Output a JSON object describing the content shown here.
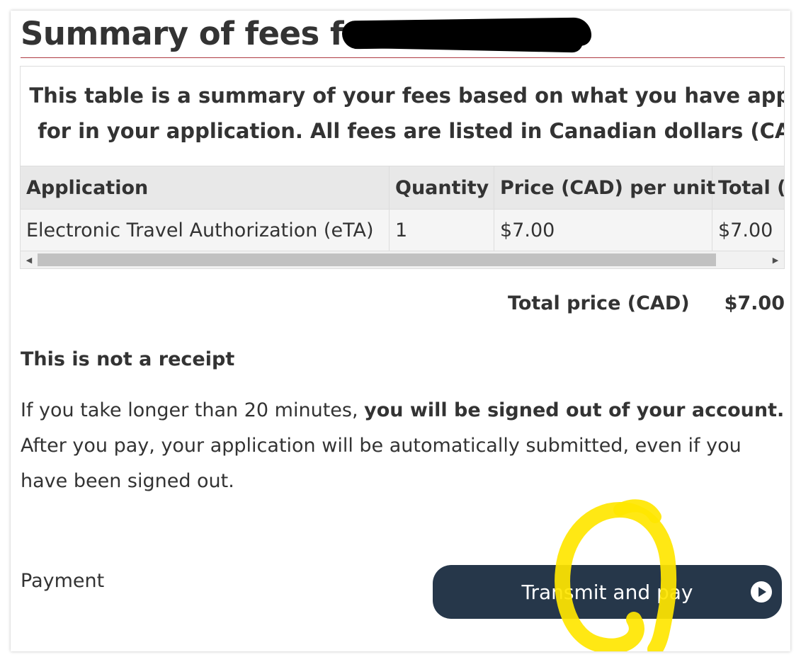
{
  "page": {
    "title": "Summary of fees for",
    "rule_color": "#af3c43"
  },
  "fees_table": {
    "caption_line1": "This table is a summary of your fees based on what you have applied",
    "caption_line2": "for in your application. All fees are listed in Canadian dollars (CAD).",
    "headers": [
      "Application",
      "Quantity",
      "Price (CAD) per unit",
      "Total (CAD)"
    ],
    "rows": [
      [
        "Electronic Travel Authorization (eTA)",
        "1",
        "$7.00",
        "$7.00"
      ]
    ]
  },
  "total": {
    "label": "Total price (CAD)",
    "value": "$7.00"
  },
  "notice": {
    "heading": "This is not a receipt",
    "text_before": "If you take longer than 20 minutes, ",
    "text_bold": "you will be signed out of your account.",
    "text_after": " After you pay, your application will be automatically submitted, even if you have been signed out."
  },
  "payment": {
    "label": "Payment",
    "button_label": "Transmit and pay",
    "button_icon": "play-circle-icon",
    "button_color": "#26374a",
    "highlight_color": "#ffe600"
  }
}
